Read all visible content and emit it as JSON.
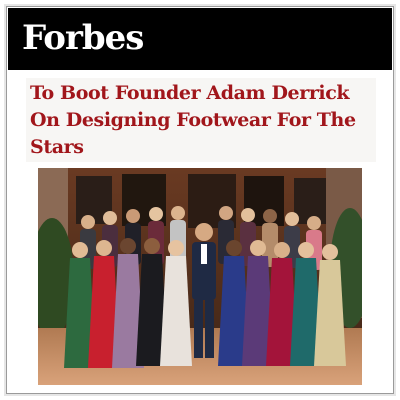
{
  "brand": {
    "logo_text": "Forbes",
    "color": "#000000"
  },
  "article": {
    "headline": "To Boot Founder Adam Derrick On Designing Footwear For The Stars",
    "headline_color": "#a1161b",
    "photo": {
      "subject": "group-photo"
    }
  }
}
